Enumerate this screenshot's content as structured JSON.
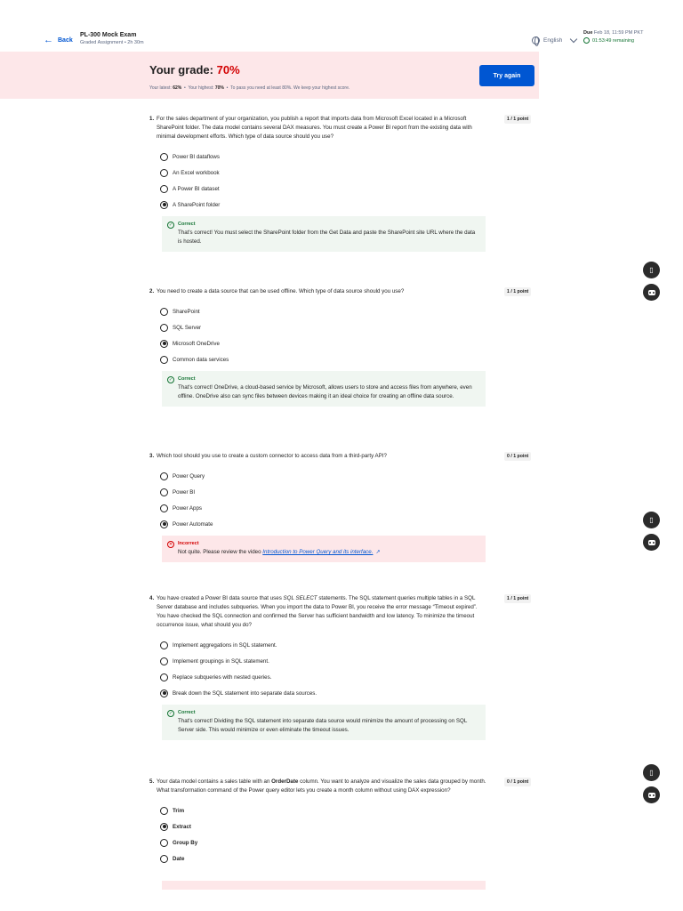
{
  "header": {
    "back_label": "Back",
    "exam_title": "PL-300 Mock Exam",
    "exam_subtitle": "Graded Assignment • 2h 30m",
    "language": "English",
    "due_label": "Due",
    "due_date": "Feb 18, 11:59 PM PKT",
    "remaining": "01:53:49 remaining"
  },
  "grade": {
    "title_prefix": "Your grade: ",
    "percent": "70%",
    "latest_label": "Your latest:",
    "latest": "62%",
    "highest_label": "Your highest:",
    "highest": "70%",
    "note": "To pass you need at least 80%. We keep your highest score.",
    "try_again": "Try again"
  },
  "questions": [
    {
      "num": "1.",
      "text": "For the sales department of your organization, you publish a report that imports data from Microsoft Excel located in a Microsoft SharePoint folder. The data model contains several DAX measures. You must create a Power BI report from the existing data with minimal development efforts. Which type of data source should you use?",
      "points": "1 / 1 point",
      "options": [
        "Power BI dataflows",
        "An Excel workbook",
        "A Power BI dataset",
        "A SharePoint folder"
      ],
      "selected": 3,
      "feedback_label": "Correct",
      "feedback": "That's correct! You must select the SharePoint folder from the Get Data and paste the SharePoint site URL where the data is hosted."
    },
    {
      "num": "2.",
      "text": "You need to create a data source that can be used offline. Which type of data source should you use?",
      "points": "1 / 1 point",
      "options": [
        "SharePoint",
        "SQL Server",
        "Microsoft OneDrive",
        "Common data services"
      ],
      "selected": 2,
      "feedback_label": "Correct",
      "feedback": "That's correct! OneDrive, a cloud-based service by Microsoft, allows users to store and access files from anywhere, even offline. OneDrive also can sync files between devices making it an ideal choice for creating an offline data source."
    },
    {
      "num": "3.",
      "text": "Which tool should you use to create a custom connector to access data from a third-party API?",
      "points": "0 / 1 point",
      "options": [
        "Power Query",
        "Power BI",
        "Power Apps",
        "Power Automate"
      ],
      "selected": 3,
      "feedback_label": "Incorrect",
      "feedback_prefix": "Not quite. Please review the video ",
      "feedback_link": "Introduction to Power Query and its interface."
    },
    {
      "num": "4.",
      "text_a": "You have created a Power BI data source that uses ",
      "text_italic": "SQL SELECT",
      "text_b": " statements. The SQL statement queries multiple tables in a SQL Server database and includes subqueries. When you import the data to Power BI, you receive the error message “Timeout expired”. You have checked the SQL connection and confirmed the Server has sufficient bandwidth and low latency. To minimize the timeout occurrence issue, what should you do?",
      "points": "1 / 1 point",
      "options": [
        "Implement aggregations in SQL statement.",
        "Implement groupings in SQL statement.",
        "Replace subqueries with nested queries.",
        "Break down the SQL statement into separate data sources."
      ],
      "selected": 3,
      "feedback_label": "Correct",
      "feedback": "That's correct! Dividing the SQL statement into separate data source would minimize the amount of processing on SQL Server side. This would minimize or even eliminate the timeout issues."
    },
    {
      "num": "5.",
      "text_a": "Your data model contains a sales table with an ",
      "text_bold": "OrderDate",
      "text_b": " column. You want to analyze and visualize the sales data grouped by month. What transformation command of the Power query editor lets you create a month column without using DAX expression?",
      "points": "0 / 1 point",
      "options": [
        "Trim",
        "Extract",
        "Group By",
        "Date"
      ],
      "selected": 1
    }
  ]
}
